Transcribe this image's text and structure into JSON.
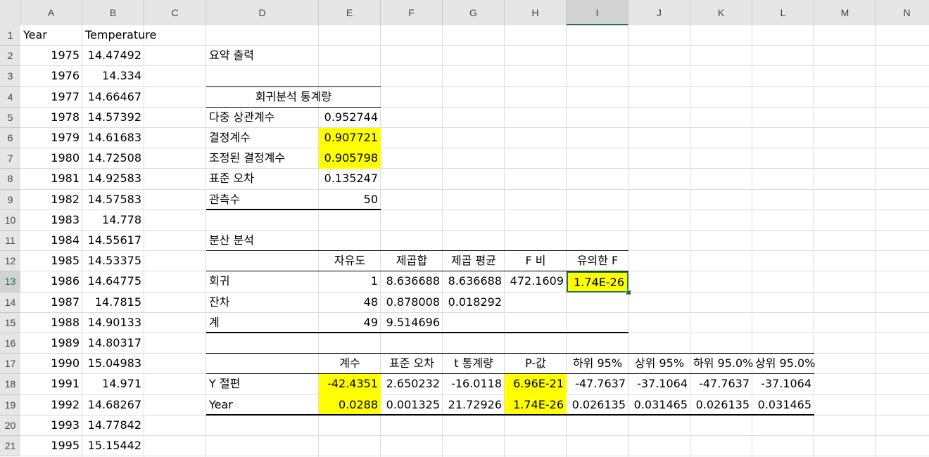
{
  "columns": [
    "A",
    "B",
    "C",
    "D",
    "E",
    "F",
    "G",
    "H",
    "I",
    "J",
    "K",
    "L",
    "M",
    "N"
  ],
  "rows": [
    "1",
    "2",
    "3",
    "4",
    "5",
    "6",
    "7",
    "8",
    "9",
    "10",
    "11",
    "12",
    "13",
    "14",
    "15",
    "16",
    "17",
    "18",
    "19",
    "20",
    "21"
  ],
  "data_table": {
    "header_year": "Year",
    "header_temp": "Temperature",
    "years": [
      "1975",
      "1976",
      "1977",
      "1978",
      "1979",
      "1980",
      "1981",
      "1982",
      "1983",
      "1984",
      "1985",
      "1986",
      "1987",
      "1988",
      "1989",
      "1990",
      "1991",
      "1992",
      "1993",
      "1995"
    ],
    "temps": [
      "14.47492",
      "14.334",
      "14.66467",
      "14.57392",
      "14.61683",
      "14.72508",
      "14.92583",
      "14.57583",
      "14.778",
      "14.55617",
      "14.53375",
      "14.64775",
      "14.7815",
      "14.90133",
      "14.80317",
      "15.04983",
      "14.971",
      "14.68267",
      "14.77842",
      "15.15442"
    ]
  },
  "summary": {
    "title": "요약 출력",
    "reg_stats_title": "회귀분석 통계량",
    "reg_stats": [
      {
        "label": "다중 상관계수",
        "value": "0.952744",
        "highlight": false
      },
      {
        "label": "결정계수",
        "value": "0.907721",
        "highlight": true
      },
      {
        "label": "조정된 결정계수",
        "value": "0.905798",
        "highlight": true
      },
      {
        "label": "표준 오차",
        "value": "0.135247",
        "highlight": false
      },
      {
        "label": "관측수",
        "value": "50",
        "highlight": false
      }
    ],
    "anova_title": "분산 분석",
    "anova_headers": [
      "자유도",
      "제곱합",
      "제곱 평균",
      "F 비",
      "유의한 F"
    ],
    "anova_rows": [
      {
        "label": "회귀",
        "df": "1",
        "ss": "8.636688",
        "ms": "8.636688",
        "f": "472.1609",
        "sigf": "1.74E-26"
      },
      {
        "label": "잔차",
        "df": "48",
        "ss": "0.878008",
        "ms": "0.018292",
        "f": "",
        "sigf": ""
      },
      {
        "label": "계",
        "df": "49",
        "ss": "9.514696",
        "ms": "",
        "f": "",
        "sigf": ""
      }
    ],
    "coef_headers": [
      "계수",
      "표준 오차",
      "t 통계량",
      "P-값",
      "하위 95%",
      "상위 95%",
      "하위 95.0%",
      "상위 95.0%"
    ],
    "coef_rows": [
      {
        "label": "Y 절편",
        "values": [
          "-42.4351",
          "2.650232",
          "-16.0118",
          "6.96E-21",
          "-47.7637",
          "-37.1064",
          "-47.7637",
          "-37.1064"
        ]
      },
      {
        "label": "Year",
        "values": [
          "0.0288",
          "0.001325",
          "21.72926",
          "1.74E-26",
          "0.026135",
          "0.031465",
          "0.026135",
          "0.031465"
        ]
      }
    ]
  },
  "selected_cell": "I13",
  "colors": {
    "highlight": "#ffff00",
    "selection": "#217346",
    "header_bg": "#e6e6e6"
  }
}
